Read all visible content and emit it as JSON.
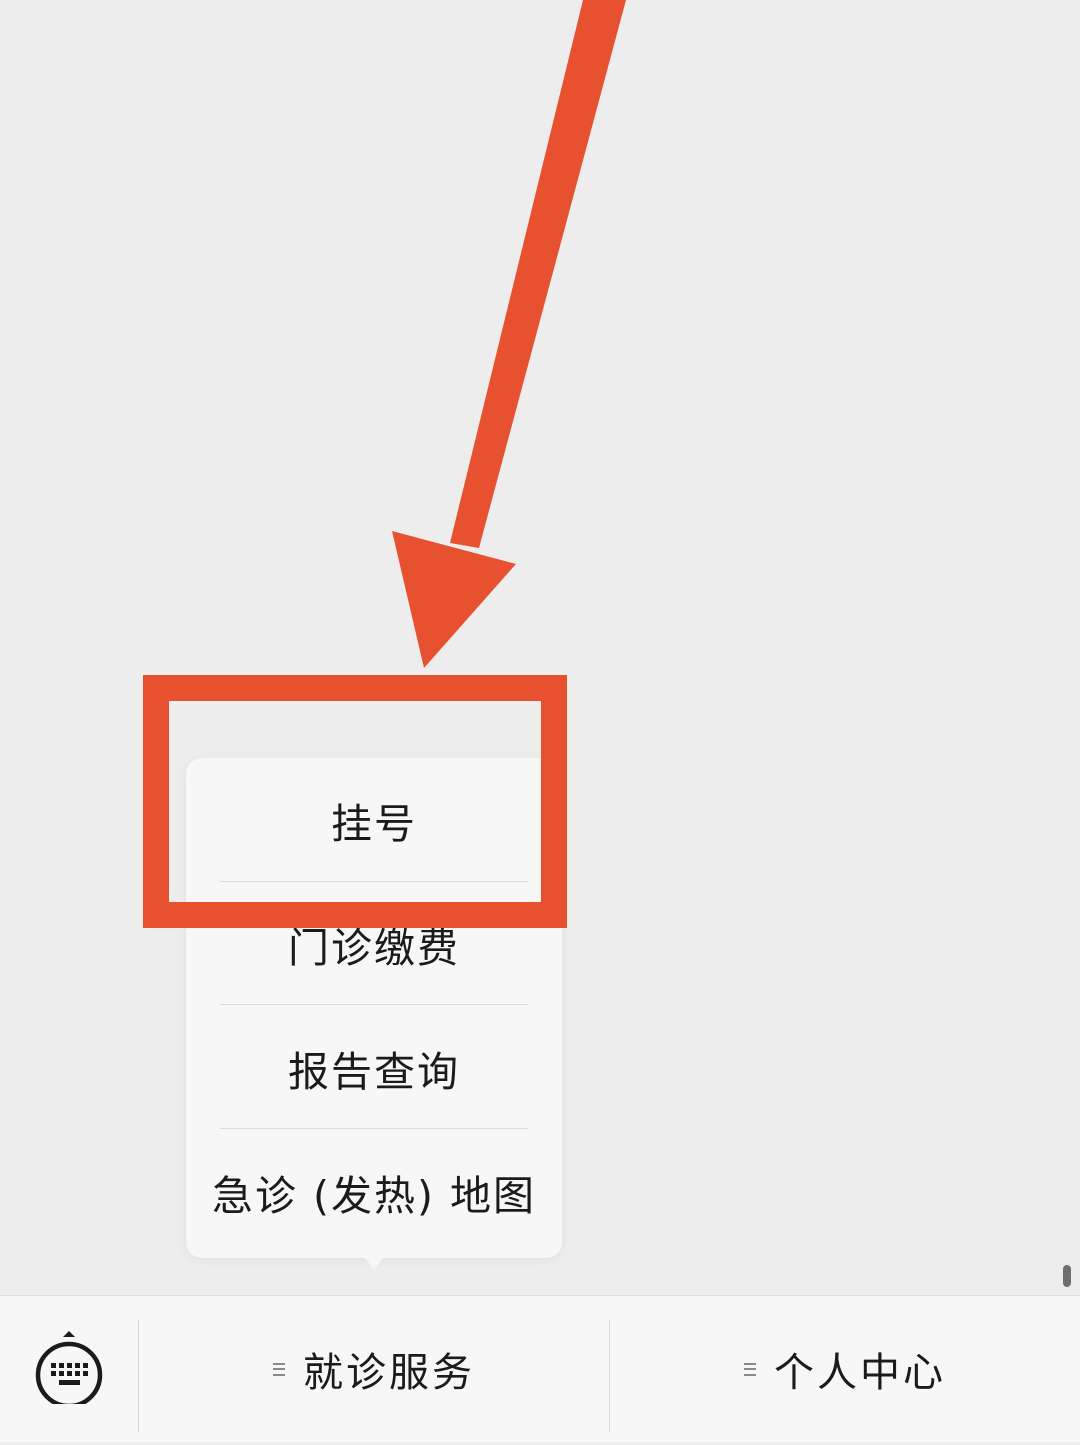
{
  "popup_menu": {
    "items": [
      {
        "label": "挂号"
      },
      {
        "label": "门诊缴费"
      },
      {
        "label": "报告查询"
      },
      {
        "label": "急诊 (发热) 地图"
      }
    ]
  },
  "bottom_menu": {
    "keyboard_icon": "keyboard-icon",
    "tabs": [
      {
        "label": "就诊服务",
        "icon": "menu-list-icon"
      },
      {
        "label": "个人中心",
        "icon": "menu-list-icon"
      }
    ]
  },
  "annotation": {
    "color": "#e8512f",
    "arrow_icon": "arrow-icon",
    "highlight_target": "挂号"
  },
  "colors": {
    "background": "#ededed",
    "menu_background": "#f7f7f7",
    "text": "#1b1b1b"
  }
}
